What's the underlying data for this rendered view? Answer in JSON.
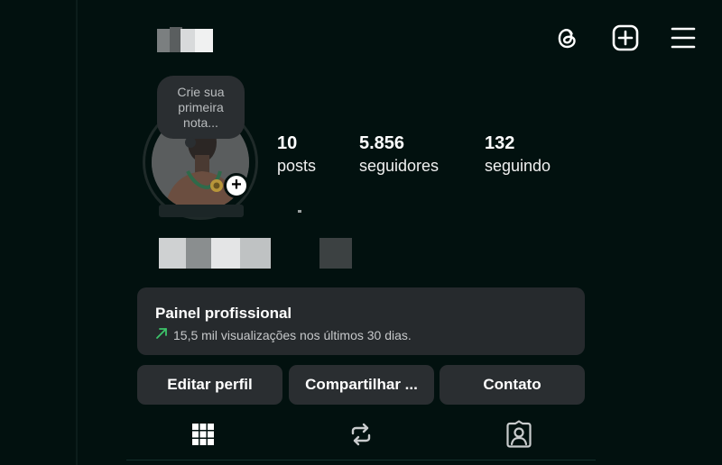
{
  "header": {
    "username_redacted": true,
    "icons": [
      "threads-icon",
      "new-post-icon",
      "menu-icon"
    ]
  },
  "note": {
    "line1": "Crie sua",
    "line2": "primeira",
    "line3": "nota..."
  },
  "stats": {
    "posts_count": "10",
    "posts_label": "posts",
    "followers_count": "5.856",
    "followers_label": "seguidores",
    "following_count": "132",
    "following_label": "seguindo"
  },
  "dashboard": {
    "title": "Painel profissional",
    "subtitle": "15,5 mil visualizações nos últimos 30 dias.",
    "trend_color": "#3dc46a"
  },
  "buttons": {
    "edit": "Editar perfil",
    "share": "Compartilhar ...",
    "contact": "Contato"
  },
  "tabs": [
    "grid-icon",
    "reposts-icon",
    "tagged-icon"
  ],
  "colors": {
    "background": "#02110f",
    "surface": "#262a2d",
    "accent_green": "#3dc46a"
  }
}
